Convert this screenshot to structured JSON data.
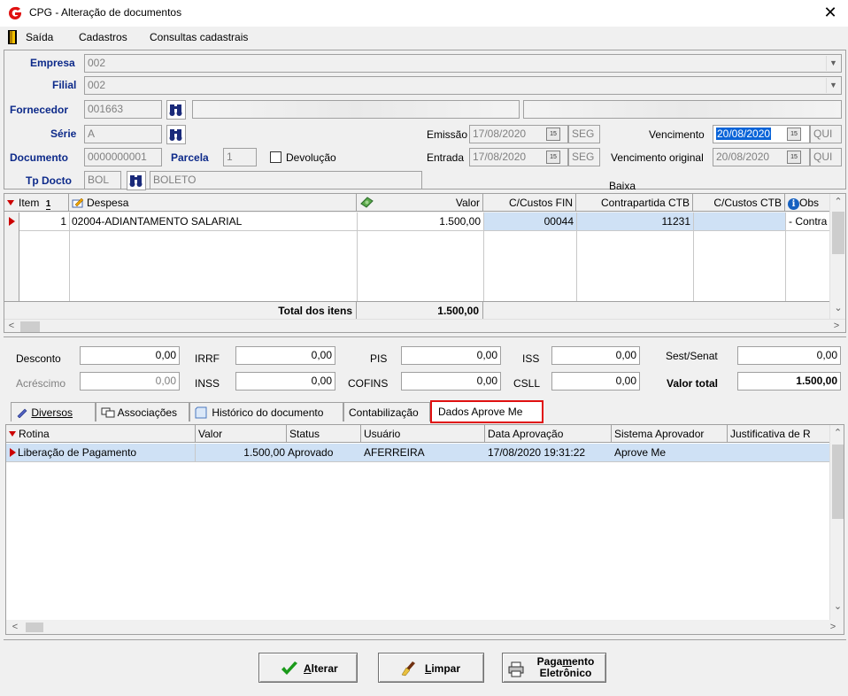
{
  "window": {
    "title": "CPG - Alteração de documentos",
    "close_glyph": "✕"
  },
  "menu": {
    "exit": "Saída",
    "items": [
      "Cadastros",
      "Consultas cadastrais"
    ]
  },
  "form": {
    "empresa": {
      "label": "Empresa",
      "value": "002"
    },
    "filial": {
      "label": "Filial",
      "value": "002"
    },
    "fornecedor": {
      "label": "Fornecedor",
      "value": "001663"
    },
    "serie": {
      "label": "Série",
      "value": "A"
    },
    "emissao": {
      "label": "Emissão",
      "value": "17/08/2020",
      "day": "SEG"
    },
    "vencimento": {
      "label": "Vencimento",
      "value": "20/08/2020",
      "day": "QUI"
    },
    "documento": {
      "label": "Documento",
      "value": "0000000001"
    },
    "parcela": {
      "label": "Parcela",
      "value": "1"
    },
    "devolucao": {
      "label": "Devolução",
      "checked": false
    },
    "entrada": {
      "label": "Entrada",
      "value": "17/08/2020",
      "day": "SEG"
    },
    "vencimento_original": {
      "label": "Vencimento original",
      "value": "20/08/2020",
      "day": "QUI"
    },
    "tp_docto": {
      "label": "Tp Docto",
      "value": "BOL",
      "description": "BOLETO"
    },
    "baixa": {
      "label": "Baixa"
    },
    "calendar_glyph": "15"
  },
  "items_grid": {
    "columns": [
      "Item",
      "Despesa",
      "",
      "Valor",
      "C/Custos FIN",
      "Contrapartida CTB",
      "C/Custos CTB",
      "Obs"
    ],
    "sort_marker": "1",
    "rows": [
      {
        "item": "1",
        "despesa": "02004-ADIANTAMENTO SALARIAL",
        "valor": "1.500,00",
        "ccustos_fin": "00044",
        "contrapartida_ctb": "11231",
        "ccustos_ctb": "",
        "obs": "- Contra"
      }
    ],
    "total_label": "Total dos itens",
    "total_value": "1.500,00"
  },
  "totals": {
    "desconto": {
      "label": "Desconto",
      "value": "0,00"
    },
    "irrf": {
      "label": "IRRF",
      "value": "0,00"
    },
    "pis": {
      "label": "PIS",
      "value": "0,00"
    },
    "iss": {
      "label": "ISS",
      "value": "0,00"
    },
    "sest_senat": {
      "label": "Sest/Senat",
      "value": "0,00"
    },
    "acrescimo": {
      "label": "Acréscimo",
      "value": "0,00"
    },
    "inss": {
      "label": "INSS",
      "value": "0,00"
    },
    "cofins": {
      "label": "COFINS",
      "value": "0,00"
    },
    "csll": {
      "label": "CSLL",
      "value": "0,00"
    },
    "valor_total": {
      "label": "Valor total",
      "value": "1.500,00"
    }
  },
  "tabs": [
    {
      "label": "Diversos",
      "active": false
    },
    {
      "label": "Associações",
      "active": false
    },
    {
      "label": "Histórico do documento",
      "active": false
    },
    {
      "label": "Contabilização",
      "active": false
    },
    {
      "label": "Dados Aprove Me",
      "active": true
    }
  ],
  "approval_grid": {
    "columns": [
      "Rotina",
      "Valor",
      "Status",
      "Usuário",
      "Data Aprovação",
      "Sistema Aprovador",
      "Justificativa de R"
    ],
    "rows": [
      {
        "rotina": "Liberação de Pagamento",
        "valor": "1.500,00",
        "status": "Aprovado",
        "usuario": "AFERREIRA",
        "data": "17/08/2020 19:31:22",
        "sistema": "Aprove Me",
        "justificativa": ""
      }
    ]
  },
  "buttons": {
    "alterar": {
      "label_u": "A",
      "label_rest": "lterar"
    },
    "limpar": {
      "label_u": "L",
      "label_rest": "impar"
    },
    "pagamento": {
      "line1_pre": "Paga",
      "line1_u": "m",
      "line1_post": "ento",
      "line2": "Eletrônico"
    }
  },
  "colors": {
    "accent_red": "#e01010",
    "label_blue": "#0d2a8a",
    "selection_blue": "#0a64d8",
    "row_highlight": "#cfe1f5"
  }
}
